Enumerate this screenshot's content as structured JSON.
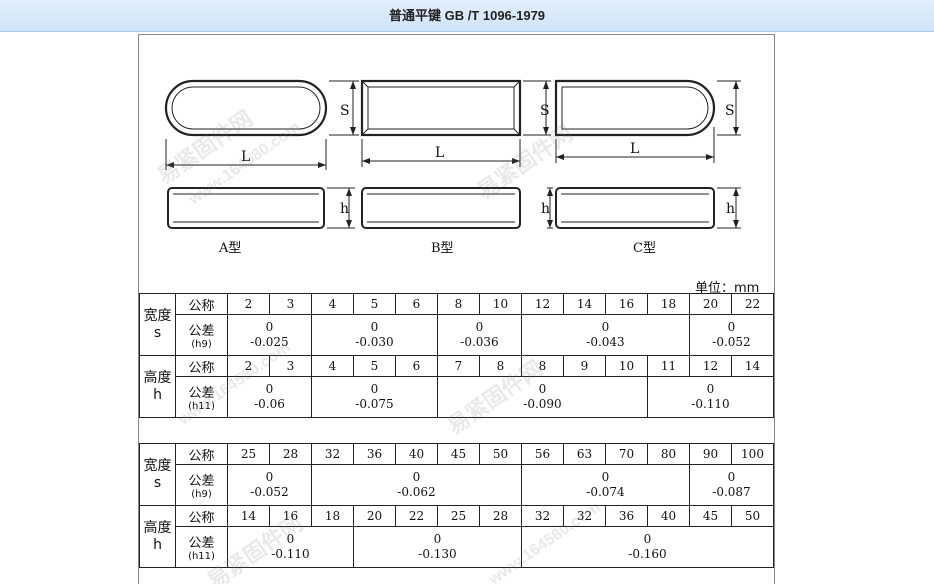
{
  "page": {
    "title": "普通平键 GB /T 1096-1979"
  },
  "diagram": {
    "dim_S": "S",
    "dim_L": "L",
    "dim_h": "h",
    "label_a": "A型",
    "label_b": "B型",
    "label_c": "C型"
  },
  "unit": "单位：mm",
  "table1": {
    "width_label": [
      "宽度",
      "s"
    ],
    "height_label": [
      "高度",
      "h"
    ],
    "nominal": "公称",
    "tolerance": "公差",
    "tol_h9": "(h9)",
    "tol_h11": "(h11)",
    "s_values": [
      "2",
      "3",
      "4",
      "5",
      "6",
      "8",
      "10",
      "12",
      "14",
      "16",
      "18",
      "20",
      "22"
    ],
    "s_tol": [
      {
        "upper": "0",
        "lower": "-0.025"
      },
      {
        "upper": "0",
        "lower": "-0.030"
      },
      {
        "upper": "0",
        "lower": "-0.036"
      },
      {
        "upper": "0",
        "lower": "-0.043"
      },
      {
        "upper": "0",
        "lower": "-0.052"
      }
    ],
    "h_values": [
      "2",
      "3",
      "4",
      "5",
      "6",
      "7",
      "8",
      "8",
      "9",
      "10",
      "11",
      "12",
      "14"
    ],
    "h_tol": [
      {
        "upper": "0",
        "lower": "-0.06"
      },
      {
        "upper": "0",
        "lower": "-0.075"
      },
      {
        "upper": "0",
        "lower": "-0.090"
      },
      {
        "upper": "0",
        "lower": "-0.110"
      }
    ]
  },
  "table2": {
    "s_values": [
      "25",
      "28",
      "32",
      "36",
      "40",
      "45",
      "50",
      "56",
      "63",
      "70",
      "80",
      "90",
      "100"
    ],
    "s_tol": [
      {
        "upper": "0",
        "lower": "-0.052"
      },
      {
        "upper": "0",
        "lower": "-0.062"
      },
      {
        "upper": "0",
        "lower": "-0.074"
      },
      {
        "upper": "0",
        "lower": "-0.087"
      }
    ],
    "h_values": [
      "14",
      "16",
      "18",
      "20",
      "22",
      "25",
      "28",
      "32",
      "32",
      "36",
      "40",
      "45",
      "50"
    ],
    "h_tol": [
      {
        "upper": "0",
        "lower": "-0.110"
      },
      {
        "upper": "0",
        "lower": "-0.130"
      },
      {
        "upper": "0",
        "lower": "-0.160"
      }
    ]
  },
  "watermark": {
    "text_a": "易紧固件网",
    "text_b": "www.164580.com"
  }
}
